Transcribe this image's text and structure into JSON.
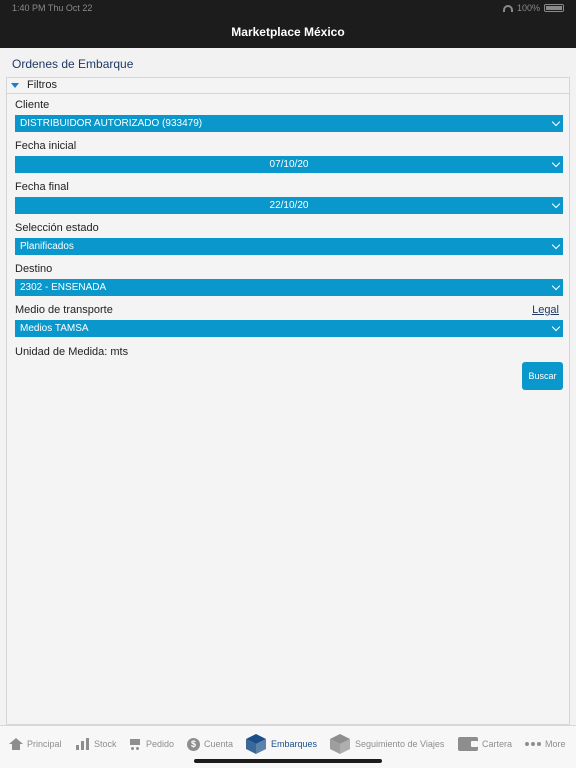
{
  "status": {
    "time": "1:40 PM",
    "date": "Thu Oct 22",
    "battery": "100%"
  },
  "app_title": "Marketplace México",
  "page_title": "Ordenes de Embarque",
  "filters": {
    "header": "Filtros",
    "cliente": {
      "label": "Cliente",
      "value": "DISTRIBUIDOR AUTORIZADO (933479)"
    },
    "fecha_inicial": {
      "label": "Fecha inicial",
      "value": "07/10/20"
    },
    "fecha_final": {
      "label": "Fecha final",
      "value": "22/10/20"
    },
    "estado": {
      "label": "Selección estado",
      "value": "Planificados"
    },
    "destino": {
      "label": "Destino",
      "value": "2302 - ENSENADA"
    },
    "transporte": {
      "label": "Medio de transporte",
      "value": "Medios TAMSA",
      "link": "Legal"
    },
    "unidad": "Unidad de Medida: mts",
    "buscar": "Buscar"
  },
  "colors": {
    "accent": "#0a98cc",
    "nav_bg": "#1c1c1c",
    "title_blue": "#1f3a66",
    "active_tab": "#1a4f8a"
  },
  "tabs": [
    {
      "label": "Principal",
      "icon": "home-icon"
    },
    {
      "label": "Stock",
      "icon": "stock-icon"
    },
    {
      "label": "Pedido",
      "icon": "cart-icon"
    },
    {
      "label": "Cuenta",
      "icon": "dollar-icon"
    },
    {
      "label": "Embarques",
      "icon": "box-icon",
      "active": true
    },
    {
      "label": "Seguimiento de Viajes",
      "icon": "box-icon"
    },
    {
      "label": "Cartera",
      "icon": "wallet-icon"
    },
    {
      "label": "More",
      "icon": "more-icon"
    }
  ]
}
